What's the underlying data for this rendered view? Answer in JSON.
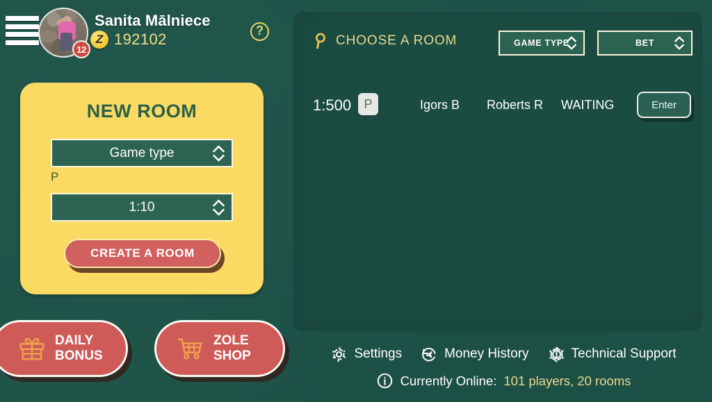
{
  "header": {
    "menu_icon": "hamburger-menu-icon",
    "avatar_icon": "user-avatar-photo",
    "level_badge": "12",
    "username": "Sanita Mālniece",
    "currency_icon": "zole-coin-icon",
    "balance": "192102",
    "help_icon": "help-question-icon"
  },
  "new_room": {
    "title": "NEW ROOM",
    "game_type_value": "Game type",
    "game_type_spinner_icon": "chevron-up-down-icon",
    "game_type_hint": "P",
    "bet_value": "1:10",
    "bet_spinner_icon": "chevron-up-down-icon",
    "create_label": "CREATE A ROOM"
  },
  "promo_buttons": [
    {
      "icon": "gift-icon",
      "line1": "DAILY",
      "line2": "BONUS"
    },
    {
      "icon": "shopping-cart-icon",
      "line1": "ZOLE",
      "line2": "SHOP"
    }
  ],
  "rooms_panel": {
    "search_icon": "magnifier-icon",
    "heading": "CHOOSE A ROOM",
    "filters": [
      {
        "label": "GAME TYPE",
        "spinner_icon": "chevron-up-down-icon"
      },
      {
        "label": "BET",
        "spinner_icon": "chevron-up-down-icon"
      }
    ],
    "rooms": [
      {
        "bet": "1:500",
        "type_chip": "P",
        "player1": "Igors B",
        "player2": "Roberts R",
        "status": "WAITING",
        "enter_label": "Enter"
      }
    ]
  },
  "footer": {
    "links": [
      {
        "icon": "gear-icon",
        "label": "Settings"
      },
      {
        "icon": "euro-refund-icon",
        "label": "Money History"
      },
      {
        "icon": "support-gear-icon",
        "label": "Technical Support"
      }
    ],
    "online_icon": "info-icon",
    "online_label": "Currently Online:",
    "online_value": "101 players, 20 rooms"
  },
  "colors": {
    "background_green": "#1e5348",
    "panel_green": "#1b4c42",
    "card_yellow": "#fada63",
    "accent_red": "#cf5b58",
    "gold_text": "#e8d98b",
    "input_green": "#2d6353",
    "icon_orange": "#f0a44a"
  }
}
